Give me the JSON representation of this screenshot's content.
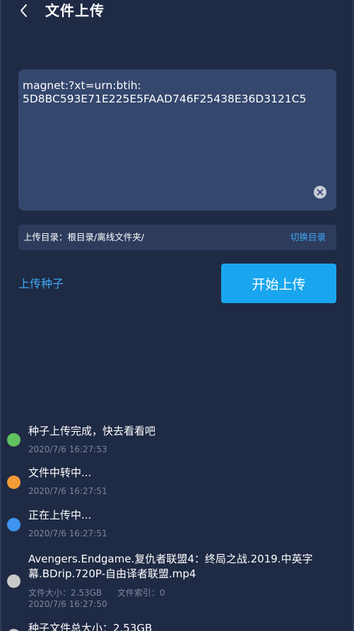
{
  "header": {
    "title": "文件上传",
    "back_icon": "chevron-left-icon"
  },
  "magnet": {
    "value": "magnet:?xt=urn:btih:\n5D8BC593E71E225E5FAAD746F25438E36D3121C5",
    "clear_icon": "close-circle-icon"
  },
  "directory": {
    "label": "上传目录：根目录/离线文件夹/",
    "switch_label": "切换目录"
  },
  "actions": {
    "upload_seed_label": "上传种子",
    "start_upload_label": "开始上传"
  },
  "colors": {
    "background": "#1f2a44",
    "panel": "#34476d",
    "bar": "#2d3c5d",
    "accent": "#3fa9f5",
    "button": "#1aa6ee",
    "dot_green": "#5fc35f",
    "dot_orange": "#f39b34",
    "dot_blue": "#3e94ef",
    "dot_grey": "#c8c8c8"
  },
  "timeline": [
    {
      "title": "种子上传完成，快去看看吧",
      "time": "2020/7/6 16:27:53",
      "color": "#5fc35f"
    },
    {
      "title": "文件中转中...",
      "time": "2020/7/6 16:27:51",
      "color": "#f39b34"
    },
    {
      "title": "正在上传中...",
      "time": "2020/7/6 16:27:51",
      "color": "#3e94ef"
    },
    {
      "title": "Avengers.Endgame.复仇者联盟4：终局之战.2019.中英字幕.BDrip.720P-自由译者联盟.mp4",
      "size": "文件大小：2.53GB",
      "index": "文件索引：0",
      "time": "2020/7/6 16:27:50",
      "color": "#c8c8c8"
    },
    {
      "title": "种子文件总大小：2.53GB",
      "color": "#c8c8c8"
    }
  ]
}
